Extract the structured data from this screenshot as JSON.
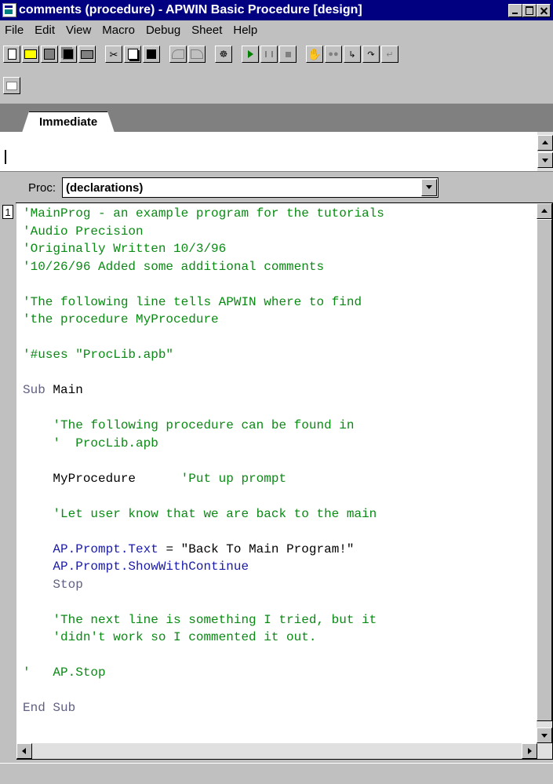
{
  "window": {
    "title": "comments (procedure) - APWIN Basic Procedure [design]",
    "icon": "apwin-icon"
  },
  "menu": [
    "File",
    "Edit",
    "View",
    "Macro",
    "Debug",
    "Sheet",
    "Help"
  ],
  "toolbar": {
    "icons": [
      "new-page-icon",
      "open-folder-icon",
      "save-disk-icon",
      "save-all-icon",
      "print-icon",
      "cut-icon",
      "copy-icon",
      "paste-icon",
      "undo-icon",
      "redo-icon",
      "dialog-editor-icon",
      "run-icon",
      "pause-icon",
      "stop-icon",
      "toggle-breakpoint-icon",
      "quick-watch-icon",
      "step-into-icon",
      "step-over-icon",
      "step-out-icon",
      "dialog-icon"
    ]
  },
  "tabs": {
    "active": "Immediate"
  },
  "proc": {
    "label": "Proc:",
    "value": "(declarations)"
  },
  "editor": {
    "line_number": "1",
    "lines": [
      "'MainProg - an example program for the tutorials",
      "'Audio Precision",
      "'Originally Written 10/3/96",
      "'10/26/96 Added some additional comments",
      "",
      "'The following line tells APWIN where to find",
      "'the procedure MyProcedure",
      "",
      "'#uses \"ProcLib.apb\"",
      "",
      "Sub Main",
      "",
      "    'The following procedure can be found in",
      "    '  ProcLib.apb",
      "",
      "    MyProcedure      'Put up prompt",
      "",
      "    'Let user know that we are back to the main",
      "",
      "    AP.Prompt.Text = \"Back To Main Program!\"",
      "    AP.Prompt.ShowWithContinue",
      "    Stop",
      "",
      "    'The next line is something I tried, but it",
      "    'didn't work so I commented it out.",
      "",
      "'   AP.Stop",
      "",
      "End Sub"
    ]
  },
  "colors": {
    "titlebar": "#000080",
    "comment": "#0a8a14",
    "keyword": "#1a1aa8"
  }
}
